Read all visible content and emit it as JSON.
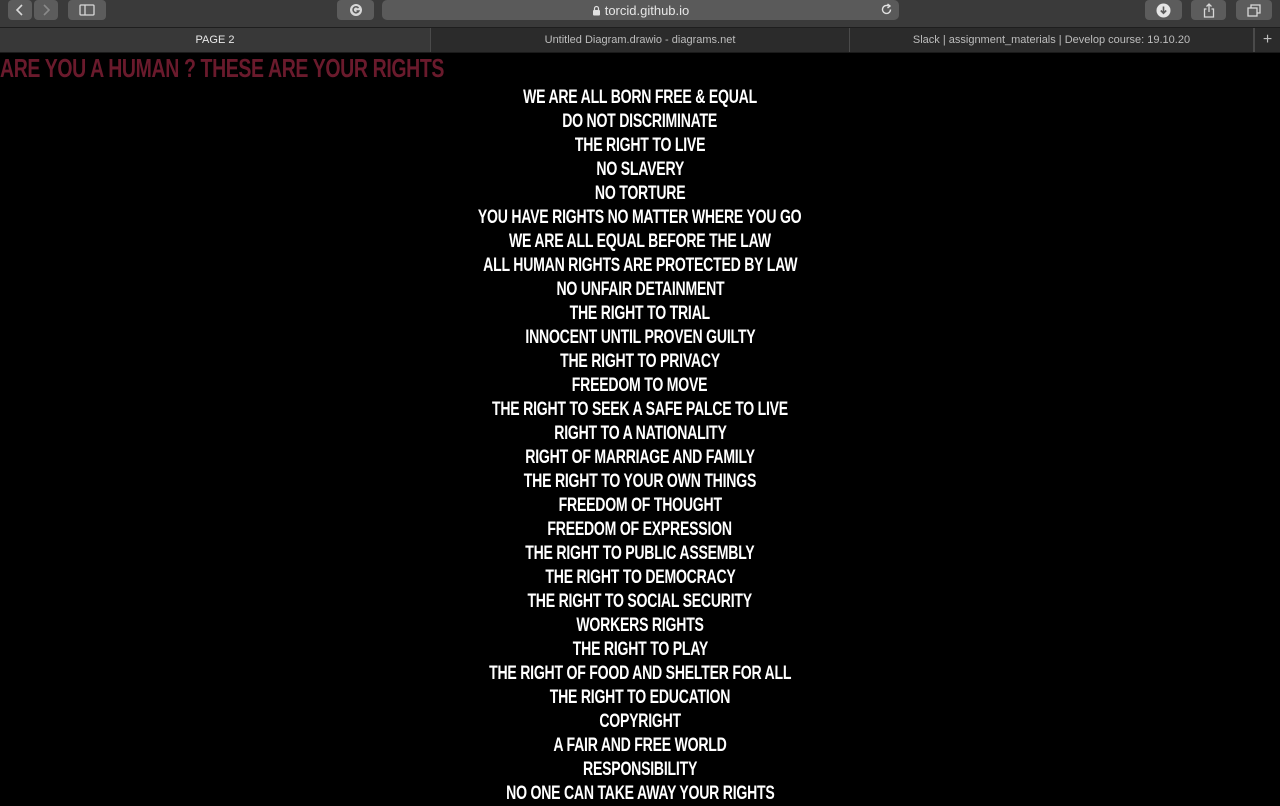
{
  "browser": {
    "url": "torcid.github.io",
    "tabs": [
      {
        "label": "PAGE 2",
        "active": true
      },
      {
        "label": "Untitled Diagram.drawio - diagrams.net",
        "active": false
      },
      {
        "label": "Slack | assignment_materials | Develop course: 19.10.20",
        "active": false
      }
    ],
    "new_tab_label": "+"
  },
  "page": {
    "heading": "ARE YOU A HUMAN ? THESE ARE YOUR RIGHTS",
    "heading_color": "#6a1a2c",
    "text_color": "#ffffff",
    "background": "#000000",
    "rights": [
      "WE ARE ALL BORN FREE & EQUAL",
      "DO NOT DISCRIMINATE",
      "THE RIGHT TO LIVE",
      "NO SLAVERY",
      "NO TORTURE",
      "YOU HAVE RIGHTS NO MATTER WHERE YOU GO",
      "WE ARE ALL EQUAL BEFORE THE LAW",
      "ALL HUMAN RIGHTS ARE PROTECTED BY LAW",
      "NO UNFAIR DETAINMENT",
      "THE RIGHT TO TRIAL",
      "INNOCENT UNTIL PROVEN GUILTY",
      "THE RIGHT TO PRIVACY",
      "FREEDOM TO MOVE",
      "THE RIGHT TO SEEK A SAFE PALCE TO LIVE",
      "RIGHT TO A NATIONALITY",
      "RIGHT OF MARRIAGE AND FAMILY",
      "THE RIGHT TO YOUR OWN THINGS",
      "FREEDOM OF THOUGHT",
      "FREEDOM OF EXPRESSION",
      "THE RIGHT TO PUBLIC ASSEMBLY",
      "THE RIGHT TO DEMOCRACY",
      "THE RIGHT TO SOCIAL SECURITY",
      "WORKERS RIGHTS",
      "THE RIGHT TO PLAY",
      "THE RIGHT OF FOOD AND SHELTER FOR ALL",
      "THE RIGHT TO EDUCATION",
      "COPYRIGHT",
      "A FAIR AND FREE WORLD",
      "RESPONSIBILITY",
      "NO ONE CAN TAKE AWAY YOUR RIGHTS"
    ]
  }
}
